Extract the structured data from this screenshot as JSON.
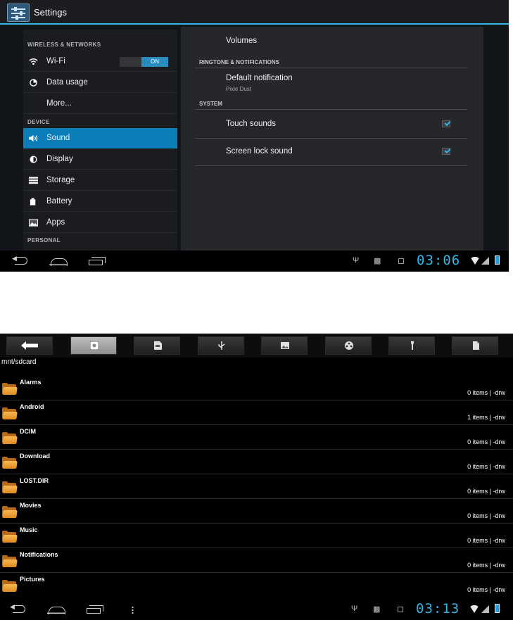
{
  "settings_screen": {
    "title": "Settings",
    "app_icon": "settings-sliders-icon",
    "left_pane": {
      "sections": [
        {
          "header": "WIRELESS & NETWORKS"
        },
        {
          "header": "DEVICE"
        },
        {
          "header": "PERSONAL"
        }
      ],
      "items": [
        {
          "label": "Wi-Fi",
          "icon": "wifi-icon",
          "toggle": "ON"
        },
        {
          "label": "Data usage",
          "icon": "data-usage-icon"
        },
        {
          "label": "More..."
        },
        {
          "label": "Sound",
          "icon": "speaker-icon",
          "selected": true
        },
        {
          "label": "Display",
          "icon": "brightness-icon"
        },
        {
          "label": "Storage",
          "icon": "storage-icon"
        },
        {
          "label": "Battery",
          "icon": "battery-icon"
        },
        {
          "label": "Apps",
          "icon": "apps-icon"
        }
      ]
    },
    "right_pane": {
      "volumes": "Volumes",
      "ringtone_header": "RINGTONE & NOTIFICATIONS",
      "default_notification": {
        "label": "Default notification",
        "value": "Pixie Dust"
      },
      "system_header": "SYSTEM",
      "touch_sounds": {
        "label": "Touch sounds",
        "checked": true
      },
      "screen_lock_sound": {
        "label": "Screen lock sound",
        "checked": true
      }
    },
    "status_bar": {
      "clock": "03:06",
      "icons": [
        "usb-icon",
        "android-debug-icon",
        "sd-card-icon",
        "wifi-icon",
        "signal-icon",
        "battery-icon"
      ]
    },
    "accent_color": "#33b5e5"
  },
  "file_screen": {
    "toolbar_buttons": [
      {
        "icon": "back-arrow-icon"
      },
      {
        "icon": "internal-storage-icon",
        "active": true
      },
      {
        "icon": "sd-card-icon"
      },
      {
        "icon": "usb-icon"
      },
      {
        "icon": "image-icon"
      },
      {
        "icon": "film-reel-icon"
      },
      {
        "icon": "wrench-icon"
      },
      {
        "icon": "document-icon"
      }
    ],
    "path": "mnt/sdcard",
    "folders": [
      {
        "name": "Alarms",
        "meta": "0 items | -drw"
      },
      {
        "name": "Android",
        "meta": "1 items | -drw"
      },
      {
        "name": "DCIM",
        "meta": "0 items | -drw"
      },
      {
        "name": "Download",
        "meta": "0 items | -drw"
      },
      {
        "name": "LOST.DIR",
        "meta": "0 items | -drw"
      },
      {
        "name": "Movies",
        "meta": "0 items | -drw"
      },
      {
        "name": "Music",
        "meta": "0 items | -drw"
      },
      {
        "name": "Notifications",
        "meta": "0 items | -drw"
      },
      {
        "name": "Pictures",
        "meta": "0 items | -drw"
      }
    ],
    "status_bar": {
      "clock": "03:13",
      "icons": [
        "usb-icon",
        "android-debug-icon",
        "sd-card-icon",
        "wifi-icon",
        "signal-icon",
        "battery-icon"
      ]
    }
  }
}
